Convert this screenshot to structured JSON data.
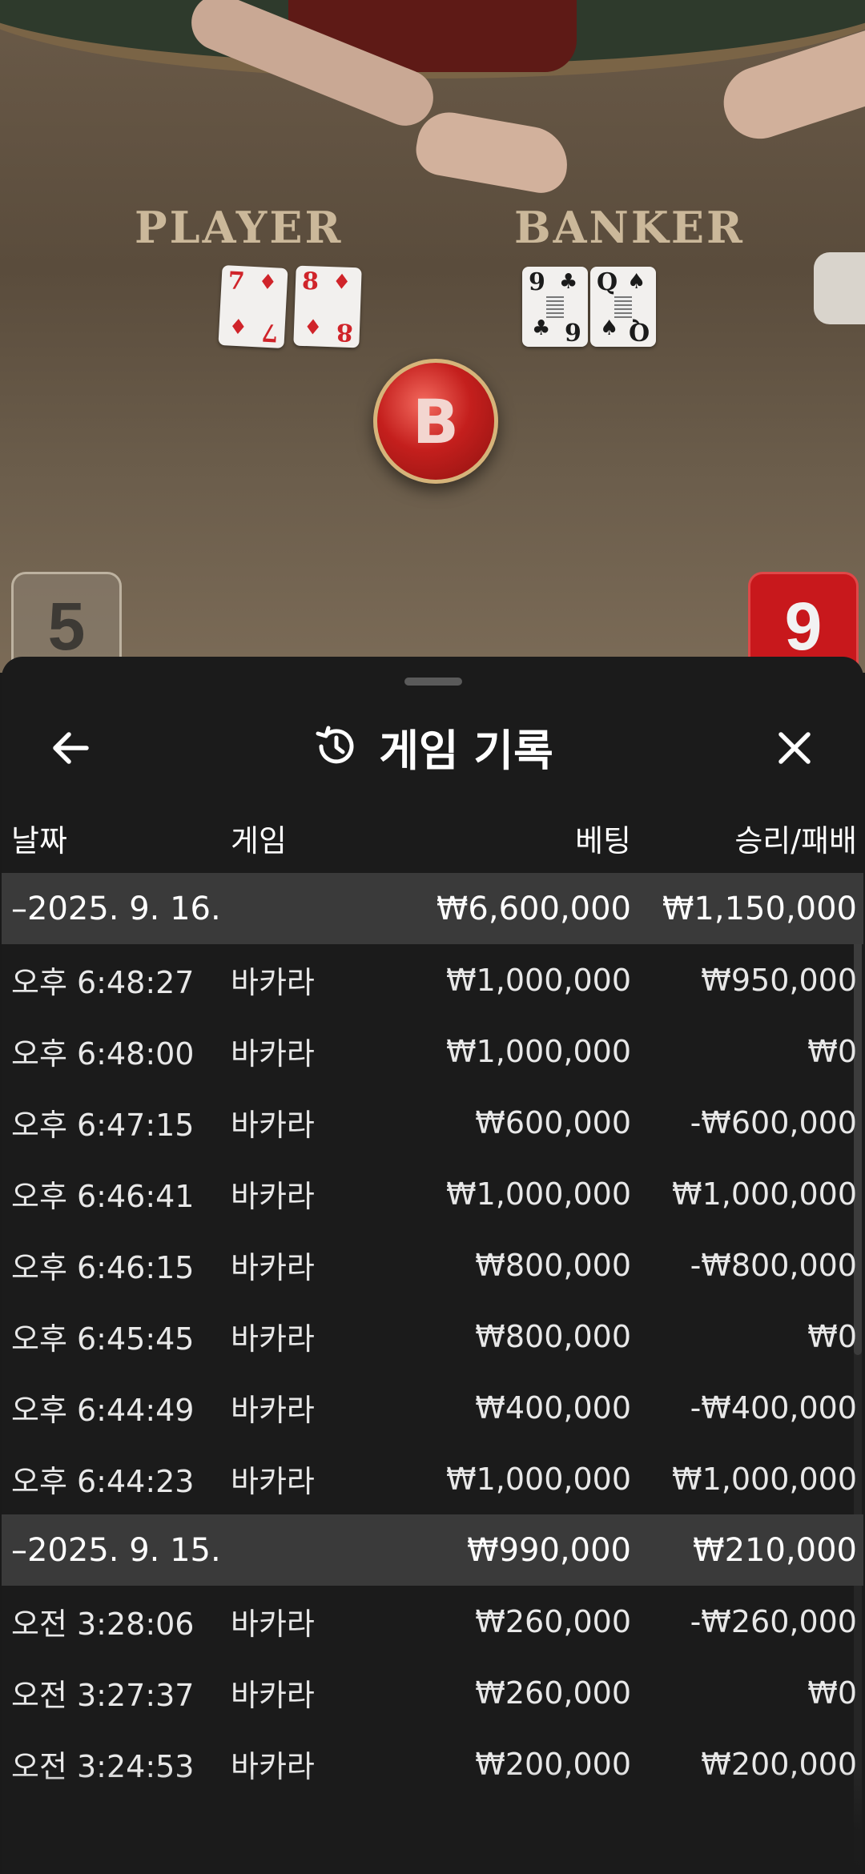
{
  "live": {
    "player_label": "PLAYER",
    "banker_label": "BANKER",
    "player_cards": [
      {
        "top": "7",
        "suit": "♦",
        "bottom": "7",
        "color": "red"
      },
      {
        "top": "8",
        "suit": "♦",
        "bottom": "8",
        "color": "red"
      }
    ],
    "banker_cards": [
      {
        "top": "9",
        "suit": "♣",
        "bottom": "6",
        "color": "blk"
      },
      {
        "top": "Q",
        "suit": "♠",
        "bottom": "Q",
        "color": "blk"
      }
    ],
    "result": "B",
    "player_score": "5",
    "banker_score": "9"
  },
  "sheet": {
    "title": "게임 기록",
    "icons": {
      "back": "arrow-left-icon",
      "history": "history-icon",
      "close": "close-icon"
    },
    "columns": {
      "date": "날짜",
      "game": "게임",
      "bet": "베팅",
      "win": "승리/패배"
    },
    "groups": [
      {
        "date": "–2025. 9. 16.",
        "bet_total": "₩6,600,000",
        "win_total": "₩1,150,000",
        "rows": [
          {
            "time": "오후 6:48:27",
            "game": "바카라",
            "bet": "₩1,000,000",
            "win": "₩950,000"
          },
          {
            "time": "오후 6:48:00",
            "game": "바카라",
            "bet": "₩1,000,000",
            "win": "₩0"
          },
          {
            "time": "오후 6:47:15",
            "game": "바카라",
            "bet": "₩600,000",
            "win": "-₩600,000"
          },
          {
            "time": "오후 6:46:41",
            "game": "바카라",
            "bet": "₩1,000,000",
            "win": "₩1,000,000"
          },
          {
            "time": "오후 6:46:15",
            "game": "바카라",
            "bet": "₩800,000",
            "win": "-₩800,000"
          },
          {
            "time": "오후 6:45:45",
            "game": "바카라",
            "bet": "₩800,000",
            "win": "₩0"
          },
          {
            "time": "오후 6:44:49",
            "game": "바카라",
            "bet": "₩400,000",
            "win": "-₩400,000"
          },
          {
            "time": "오후 6:44:23",
            "game": "바카라",
            "bet": "₩1,000,000",
            "win": "₩1,000,000"
          }
        ]
      },
      {
        "date": "–2025. 9. 15.",
        "bet_total": "₩990,000",
        "win_total": "₩210,000",
        "rows": [
          {
            "time": "오전 3:28:06",
            "game": "바카라",
            "bet": "₩260,000",
            "win": "-₩260,000"
          },
          {
            "time": "오전 3:27:37",
            "game": "바카라",
            "bet": "₩260,000",
            "win": "₩0"
          },
          {
            "time": "오전 3:24:53",
            "game": "바카라",
            "bet": "₩200,000",
            "win": "₩200,000"
          }
        ]
      }
    ]
  }
}
